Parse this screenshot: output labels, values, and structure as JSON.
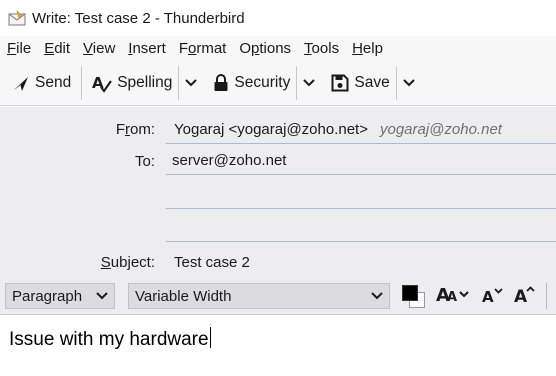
{
  "window": {
    "title": "Write: Test case 2 - Thunderbird"
  },
  "menubar": [
    {
      "id": "file",
      "pre": "",
      "acc": "F",
      "post": "ile"
    },
    {
      "id": "edit",
      "pre": "",
      "acc": "E",
      "post": "dit"
    },
    {
      "id": "view",
      "pre": "",
      "acc": "V",
      "post": "iew"
    },
    {
      "id": "insert",
      "pre": "",
      "acc": "I",
      "post": "nsert"
    },
    {
      "id": "format",
      "pre": "F",
      "acc": "o",
      "post": "rmat"
    },
    {
      "id": "options",
      "pre": "O",
      "acc": "p",
      "post": "tions"
    },
    {
      "id": "tools",
      "pre": "",
      "acc": "T",
      "post": "ools"
    },
    {
      "id": "help",
      "pre": "",
      "acc": "H",
      "post": "elp"
    }
  ],
  "toolbar": {
    "send": "Send",
    "spelling": "Spelling",
    "security": "Security",
    "save": "Save"
  },
  "headers": {
    "from_label_pre": "F",
    "from_label_acc": "r",
    "from_label_post": "om:",
    "from_identity": "Yogaraj <yogaraj@zoho.net>",
    "from_email": "yogaraj@zoho.net",
    "to_label": "To:",
    "to_value": "server@zoho.net",
    "subject_label_pre": "",
    "subject_label_acc": "S",
    "subject_label_post": "ubject:",
    "subject_value": "Test case 2"
  },
  "format": {
    "paragraph": "Paragraph",
    "font": "Variable Width",
    "text_color": "#000000",
    "background_color": "#ffffff"
  },
  "body": {
    "text": "Issue with my hardware"
  }
}
